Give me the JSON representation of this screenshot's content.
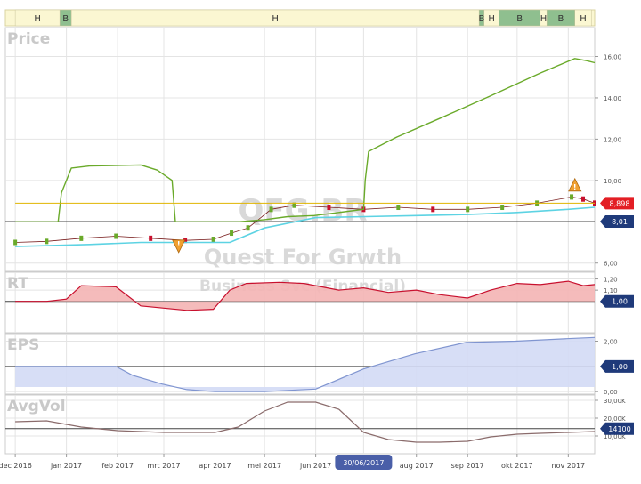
{
  "chart_data": {
    "type": "line",
    "ticker": "QFG.BR",
    "company_name": "Quest For Grwth",
    "sector": "Business Svc (Financial)",
    "signal_bar": {
      "labels": [
        "H",
        "B",
        "H",
        "B",
        "H",
        "B",
        "H",
        "B",
        "H"
      ],
      "segments": [
        {
          "label": "H",
          "state": "hold",
          "start": "2016-12-01",
          "end": "2016-12-28"
        },
        {
          "label": "B",
          "state": "buy",
          "start": "2016-12-28",
          "end": "2017-01-04"
        },
        {
          "label": "H",
          "state": "hold",
          "start": "2017-01-04",
          "end": "2017-09-08"
        },
        {
          "label": "B",
          "state": "buy",
          "start": "2017-09-08",
          "end": "2017-09-11"
        },
        {
          "label": "H",
          "state": "hold",
          "start": "2017-09-11",
          "end": "2017-09-20"
        },
        {
          "label": "B",
          "state": "buy",
          "start": "2017-09-20",
          "end": "2017-10-15"
        },
        {
          "label": "H",
          "state": "hold",
          "start": "2017-10-15",
          "end": "2017-10-19"
        },
        {
          "label": "B",
          "state": "buy",
          "start": "2017-10-19",
          "end": "2017-11-05"
        },
        {
          "label": "H",
          "state": "hold",
          "start": "2017-11-05",
          "end": "2017-11-15"
        }
      ]
    },
    "x_tick_labels": [
      "dec 2016",
      "jan 2017",
      "feb 2017",
      "mrt 2017",
      "apr 2017",
      "mei 2017",
      "jun 2017",
      "30/06/2017",
      "aug 2017",
      "sep 2017",
      "okt 2017",
      "nov 2017"
    ],
    "x_tick_dates": [
      "2016-12-01",
      "2017-01-01",
      "2017-02-01",
      "2017-03-01",
      "2017-04-01",
      "2017-05-01",
      "2017-06-01",
      "2017-06-30",
      "2017-08-01",
      "2017-09-01",
      "2017-10-01",
      "2017-11-01"
    ],
    "panels": [
      {
        "name": "Price",
        "ylim": [
          5.6,
          17.4
        ],
        "y_tick_labels": [
          "16,00",
          "14,00",
          "12,00",
          "10,00",
          "6,00"
        ],
        "y_tick_values": [
          16,
          14,
          12,
          10,
          6
        ],
        "current_value_label": "8,898",
        "reference_value_label": "8,01",
        "reference_value": 8.01,
        "annotations": [
          "!",
          "!"
        ],
        "series": [
          {
            "kind": "candles-close",
            "color": "#c8102e",
            "x": [
              "2016-12-01",
              "2016-12-20",
              "2017-01-10",
              "2017-01-31",
              "2017-02-21",
              "2017-03-14",
              "2017-03-31",
              "2017-04-11",
              "2017-04-21",
              "2017-05-05",
              "2017-05-19",
              "2017-06-09",
              "2017-06-30",
              "2017-07-21",
              "2017-08-11",
              "2017-09-01",
              "2017-09-22",
              "2017-10-13",
              "2017-11-03",
              "2017-11-10",
              "2017-11-17"
            ],
            "y": [
              7.0,
              7.05,
              7.2,
              7.3,
              7.2,
              7.1,
              7.15,
              7.45,
              7.7,
              8.6,
              8.8,
              8.7,
              8.6,
              8.7,
              8.6,
              8.6,
              8.7,
              8.9,
              9.2,
              9.1,
              8.9
            ]
          },
          {
            "kind": "moving-average",
            "color": "#5dd3e3",
            "x": [
              "2016-12-01",
              "2017-01-15",
              "2017-02-15",
              "2017-03-15",
              "2017-04-10",
              "2017-05-01",
              "2017-06-01",
              "2017-07-01",
              "2017-08-01",
              "2017-09-01",
              "2017-10-01",
              "2017-11-01",
              "2017-11-17"
            ],
            "y": [
              6.8,
              6.9,
              7.0,
              7.0,
              7.0,
              7.7,
              8.2,
              8.25,
              8.3,
              8.35,
              8.45,
              8.6,
              8.7
            ]
          },
          {
            "kind": "stop-line",
            "color": "#6aaa2a",
            "x": [
              "2016-12-01",
              "2016-12-27",
              "2016-12-29",
              "2017-01-04",
              "2017-01-15",
              "2017-02-15",
              "2017-02-25",
              "2017-03-06",
              "2017-03-08",
              "2017-04-15",
              "2017-05-01",
              "2017-05-15",
              "2017-05-31",
              "2017-06-15",
              "2017-06-30",
              "2017-07-01",
              "2017-07-03",
              "2017-07-20",
              "2017-08-15",
              "2017-09-15",
              "2017-10-15",
              "2017-11-05",
              "2017-11-12",
              "2017-11-17"
            ],
            "y": [
              8.0,
              8.0,
              9.4,
              10.6,
              10.7,
              10.75,
              10.5,
              10.0,
              8.0,
              8.0,
              8.1,
              8.25,
              8.3,
              8.45,
              8.6,
              10.0,
              11.4,
              12.1,
              13.0,
              14.1,
              15.2,
              15.9,
              15.8,
              15.7
            ]
          },
          {
            "kind": "price-level",
            "color": "#e0b400",
            "x": [
              "2016-12-01",
              "2017-11-17"
            ],
            "y": [
              8.9,
              8.9
            ]
          }
        ]
      },
      {
        "name": "RT",
        "ylim": [
          0.72,
          1.26
        ],
        "y_tick_labels": [
          "1,20",
          "1,10"
        ],
        "y_tick_values": [
          1.2,
          1.1
        ],
        "current_value_label": "1,00",
        "reference_value": 1.0,
        "series": [
          {
            "kind": "area-line",
            "color": "#c8102e",
            "fill": "#f4b4b4",
            "x": [
              "2016-12-01",
              "2016-12-20",
              "2017-01-01",
              "2017-01-10",
              "2017-01-31",
              "2017-02-15",
              "2017-03-01",
              "2017-03-15",
              "2017-03-31",
              "2017-04-10",
              "2017-04-20",
              "2017-05-10",
              "2017-05-25",
              "2017-06-15",
              "2017-06-30",
              "2017-07-15",
              "2017-08-01",
              "2017-08-15",
              "2017-09-01",
              "2017-09-15",
              "2017-10-01",
              "2017-10-15",
              "2017-11-01",
              "2017-11-10",
              "2017-11-17"
            ],
            "y": [
              1.0,
              1.0,
              1.02,
              1.14,
              1.13,
              0.96,
              0.94,
              0.92,
              0.93,
              1.1,
              1.16,
              1.17,
              1.16,
              1.1,
              1.12,
              1.08,
              1.1,
              1.06,
              1.03,
              1.1,
              1.16,
              1.15,
              1.18,
              1.14,
              1.15
            ]
          }
        ]
      },
      {
        "name": "EPS",
        "ylim": [
          -0.1,
          2.3
        ],
        "y_tick_labels": [
          "2,00",
          "0,00"
        ],
        "y_tick_values": [
          2.0,
          0.0
        ],
        "current_value_label": "1,00",
        "reference_value": 1.0,
        "series": [
          {
            "kind": "area-line",
            "color": "#8095d0",
            "fill": "#d3daf5",
            "x": [
              "2016-12-01",
              "2017-01-01",
              "2017-01-31",
              "2017-02-10",
              "2017-02-28",
              "2017-03-15",
              "2017-04-01",
              "2017-04-15",
              "2017-05-01",
              "2017-05-15",
              "2017-06-01",
              "2017-06-30",
              "2017-07-31",
              "2017-08-31",
              "2017-09-30",
              "2017-10-31",
              "2017-11-17"
            ],
            "y": [
              1.0,
              1.0,
              1.0,
              0.65,
              0.3,
              0.08,
              0.0,
              0.0,
              0.0,
              0.05,
              0.1,
              0.9,
              1.5,
              1.95,
              2.0,
              2.1,
              2.15
            ]
          }
        ]
      },
      {
        "name": "AvgVol",
        "ylim": [
          0,
          33000
        ],
        "y_tick_labels": [
          "30,00K",
          "20,00K",
          "10,00K"
        ],
        "y_tick_values": [
          30000,
          20000,
          10000
        ],
        "current_value_label": "14100",
        "reference_value": 14100,
        "series": [
          {
            "kind": "line",
            "color": "#8a6b6b",
            "x": [
              "2016-12-01",
              "2016-12-20",
              "2017-01-10",
              "2017-02-01",
              "2017-03-01",
              "2017-04-01",
              "2017-04-15",
              "2017-05-01",
              "2017-05-15",
              "2017-06-01",
              "2017-06-15",
              "2017-06-30",
              "2017-07-15",
              "2017-08-01",
              "2017-08-15",
              "2017-09-01",
              "2017-09-15",
              "2017-10-01",
              "2017-10-15",
              "2017-11-01",
              "2017-11-17"
            ],
            "y": [
              18000,
              18500,
              15000,
              13000,
              12000,
              12000,
              15000,
              24000,
              29000,
              29000,
              25000,
              12000,
              8000,
              6500,
              6500,
              7000,
              9500,
              11000,
              11500,
              12000,
              12500
            ]
          }
        ]
      }
    ],
    "colors": {
      "buy": "#8fbf8f",
      "hold": "#fbf7d2",
      "price_up": "#6aaa2a",
      "price_down": "#c8102e",
      "label_red": "#e31e24",
      "label_navy": "#1f3a7a",
      "warning": "#f0a030"
    }
  }
}
